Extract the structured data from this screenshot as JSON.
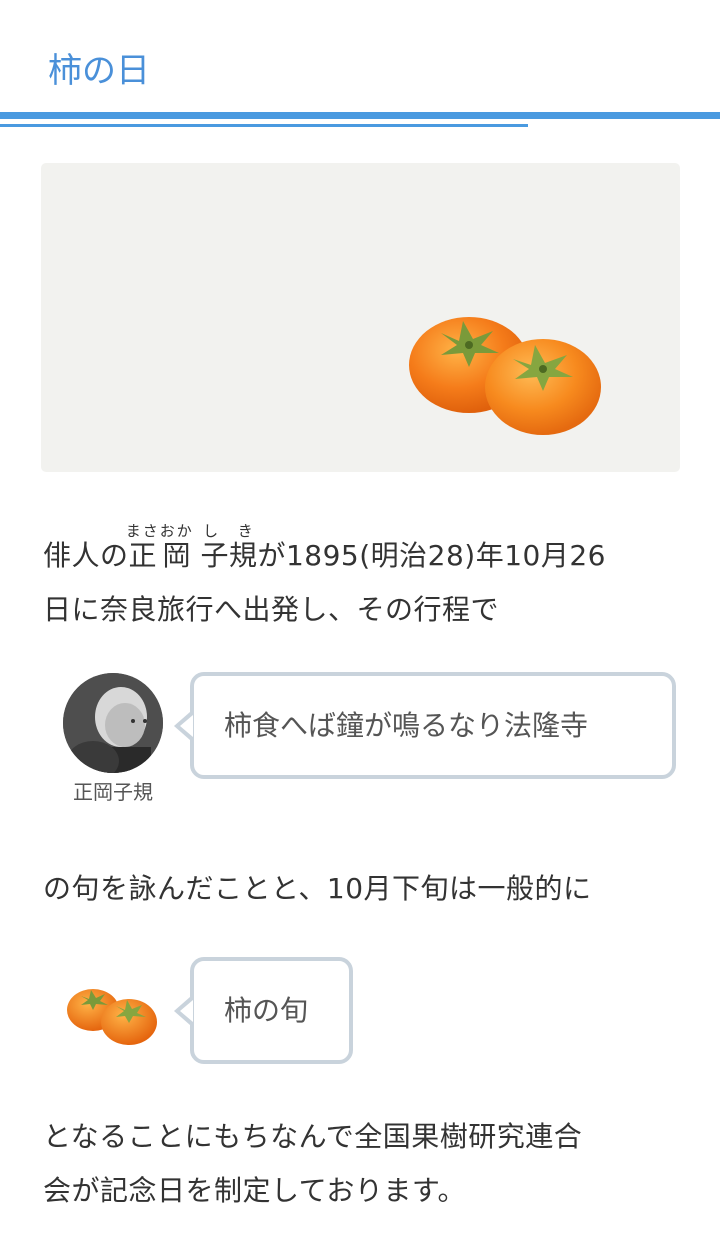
{
  "header": {
    "title": "柿の日"
  },
  "hero": {
    "image": "persimmon-pair-illustration"
  },
  "intro": {
    "prefix": "俳人の",
    "name_given1": "正",
    "name_given1_ruby": "まさ",
    "name_given2": "岡",
    "name_given2_ruby": "おか",
    "name_family": "子規",
    "name_family_ruby": "し き",
    "suffix_line1": "が1895(明治28)年10月26",
    "line2": "日に奈良旅行へ出発し、その行程で"
  },
  "speech1": {
    "avatar": "shiki-masaoka-portrait",
    "speaker": "正岡子規",
    "text": "柿食へば鐘が鳴るなり法隆寺"
  },
  "middle": {
    "text": "の句を詠んだことと、10月下旬は一般的に"
  },
  "speech2": {
    "avatar": "persimmon-icon",
    "text": "柿の旬"
  },
  "closing": {
    "line1": "となることにもちなんで全国果樹研究連合",
    "line2": "会が記念日を制定しております。"
  },
  "colors": {
    "accent": "#4a90d9",
    "rule": "#4a9ae0",
    "bubble_border": "#c9d3dc",
    "hero_bg": "#f2f2ef",
    "persimmon": "#f08a1c"
  }
}
